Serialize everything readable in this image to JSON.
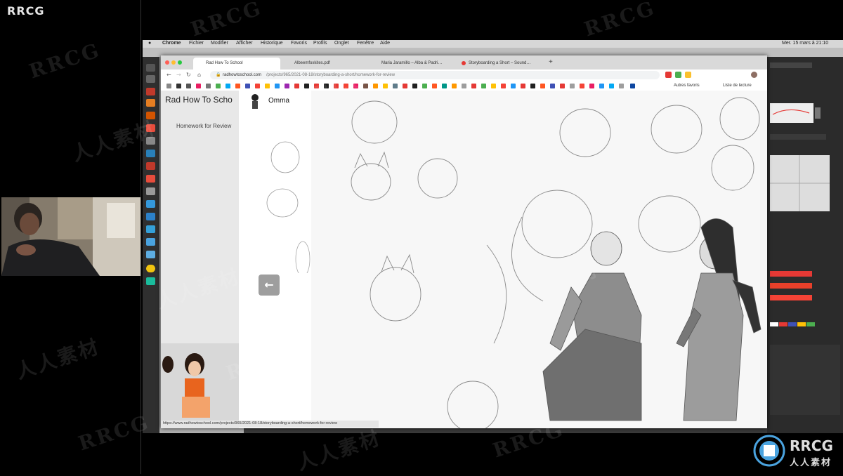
{
  "watermark": {
    "corner_text": "RRCG",
    "logo_text_1": "RRCG",
    "logo_text_2": "人人素材",
    "repeated_en": "RRCG",
    "repeated_zh": "人人素材"
  },
  "menubar": {
    "items": [
      "Chrome",
      "Fichier",
      "Modifier",
      "Afficher",
      "Historique",
      "Favoris",
      "Profils",
      "Onglet",
      "Fenêtre",
      "Aide"
    ],
    "clock": "Mer. 15 mars à 21:10"
  },
  "browser": {
    "tabs": [
      {
        "label": "Rad How To School",
        "active": true
      },
      {
        "label": "Albeemfoxkites.pdf",
        "active": false
      },
      {
        "label": "Maria Jaramillo – Alba & Padri…",
        "active": false
      },
      {
        "label": "Storyboarding a Short – Sound…",
        "active": false
      }
    ],
    "url_host": "radhowtoschool.com",
    "url_path": "/projects/965/2021-08-18/storyboarding-a-short/homework-for-review",
    "bookmarks_right": [
      "Autres favoris",
      "Liste de lecture"
    ],
    "status_url": "https://www.radhowtoschool.com/projects/965/2021-08-18/storyboarding-a-short/homework-for-review"
  },
  "page": {
    "site_title": "Rad How To Scho",
    "breadcrumb": "Homework for Review",
    "author_name": "Omma",
    "back_arrow": "←"
  },
  "colors": {
    "accent_red": "#e53935",
    "chrome_tab_bar": "#d9d9d9",
    "clip_panel": "#2b2b2b"
  }
}
